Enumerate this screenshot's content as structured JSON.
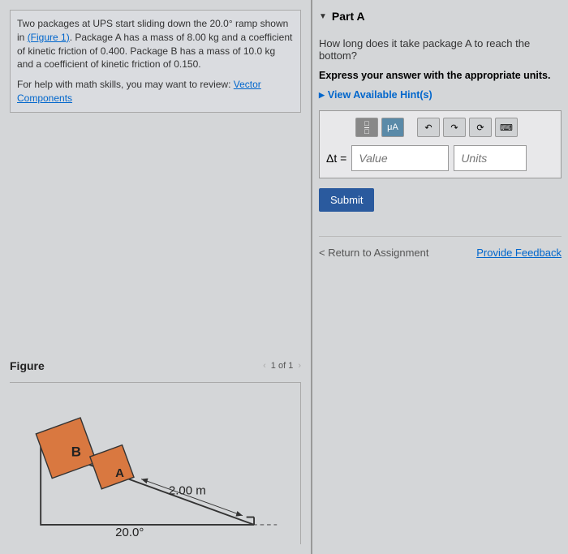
{
  "problem": {
    "text_before": "Two packages at UPS start sliding down the 20.0° ramp shown in ",
    "figure_link": "(Figure 1)",
    "text_after": ". Package A has a mass of 8.00 kg and a coefficient of kinetic friction of 0.400. Package B has a mass of 10.0 kg and a coefficient of kinetic friction of 0.150.",
    "help_text": "For help with math skills, you may want to review: ",
    "help_link": "Vector Components"
  },
  "figure": {
    "title": "Figure",
    "nav": "1 of 1",
    "labels": {
      "A": "A",
      "B": "B",
      "distance": "2.00 m",
      "angle": "20.0°"
    }
  },
  "partA": {
    "title": "Part A",
    "question": "How long does it take package A to reach the bottom?",
    "instruction": "Express your answer with the appropriate units.",
    "hints": "View Available Hint(s)",
    "var": "Δt =",
    "value_placeholder": "Value",
    "units_placeholder": "Units",
    "muA": "μA",
    "submit": "Submit"
  },
  "footer": {
    "return": "< Return to Assignment",
    "feedback": "Provide Feedback"
  }
}
